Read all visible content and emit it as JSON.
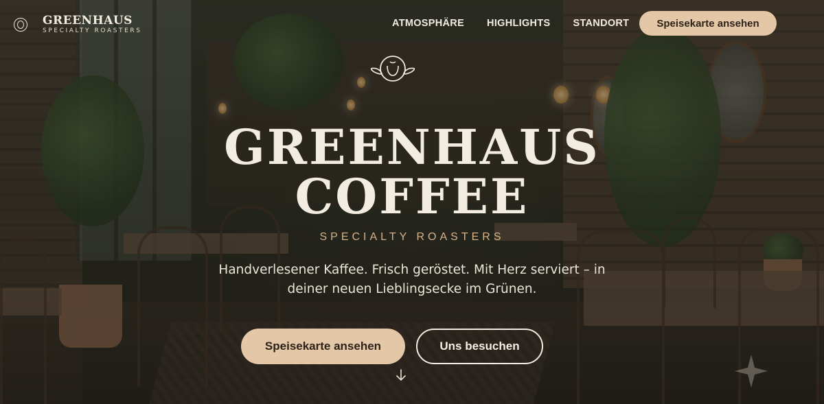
{
  "brand": {
    "name": "GREENHAUS",
    "tagline": "SPECIALTY ROASTERS",
    "logo_icon": "coffee-bean-circle-icon"
  },
  "nav": {
    "links": [
      {
        "label": "ATMOSPHÄRE"
      },
      {
        "label": "HIGHLIGHTS"
      },
      {
        "label": "STANDORT"
      }
    ],
    "cta_label": "Speisekarte ansehen"
  },
  "hero": {
    "icon": "coffee-cup-leaves-icon",
    "title_line1": "GREENHAUS",
    "title_line2": "COFFEE",
    "subtitle": "SPECIALTY ROASTERS",
    "description_line1": "Handverlesener Kaffee. Frisch geröstet. Mit Herz serviert – in",
    "description_line2": "deiner neuen Lieblingsecke im Grünen.",
    "primary_button": "Speisekarte ansehen",
    "secondary_button": "Uns besuchen",
    "scroll_icon": "arrow-down-icon"
  },
  "colors": {
    "accent": "#e4c7a6",
    "accent_text": "#d8b48c",
    "text_light": "#f3ece0"
  }
}
